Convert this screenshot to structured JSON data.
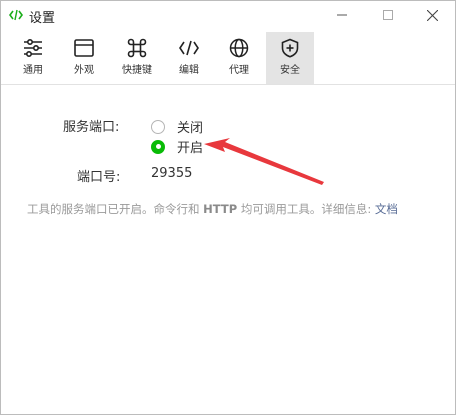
{
  "window": {
    "title": "设置"
  },
  "toolbar": {
    "items": [
      {
        "label": "通用",
        "icon": "sliders-icon"
      },
      {
        "label": "外观",
        "icon": "window-icon"
      },
      {
        "label": "快捷键",
        "icon": "command-icon"
      },
      {
        "label": "编辑",
        "icon": "code-icon"
      },
      {
        "label": "代理",
        "icon": "globe-icon"
      },
      {
        "label": "安全",
        "icon": "shield-icon",
        "active": true
      }
    ]
  },
  "security": {
    "service_port_label": "服务端口:",
    "options": [
      {
        "label": "关闭",
        "checked": false
      },
      {
        "label": "开启",
        "checked": true
      }
    ],
    "port_label": "端口号:",
    "port_value": "29355",
    "description_prefix": "工具的服务端口已开启。命令行和",
    "description_http": "HTTP",
    "description_suffix": "均可调用工具。详细信息:",
    "doc_link": "文档"
  },
  "colors": {
    "accent_green": "#09bb07",
    "annotation_red": "#e8383d",
    "link": "#576b95"
  }
}
